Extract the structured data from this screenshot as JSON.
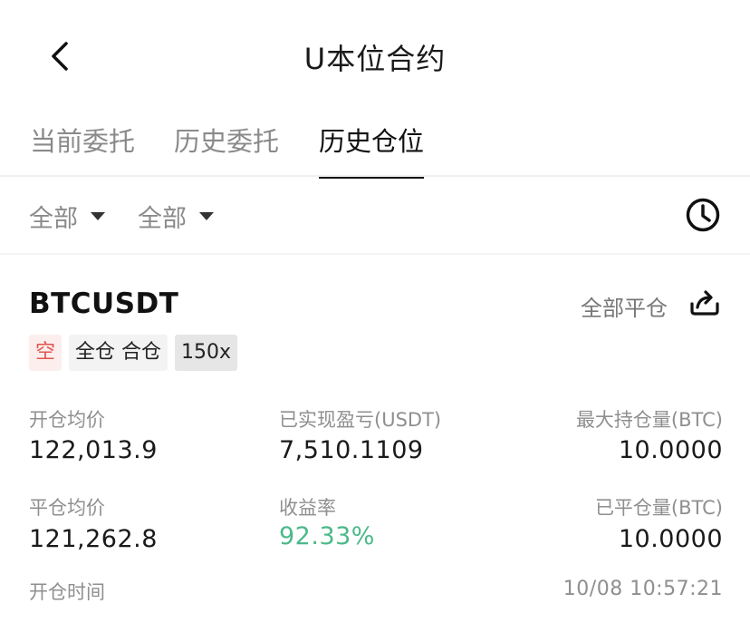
{
  "header": {
    "title": "U本位合约"
  },
  "tabs": [
    {
      "label": "当前委托",
      "active": false
    },
    {
      "label": "历史委托",
      "active": false
    },
    {
      "label": "历史仓位",
      "active": true
    }
  ],
  "filters": [
    {
      "label": "全部"
    },
    {
      "label": "全部"
    }
  ],
  "position": {
    "symbol": "BTCUSDT",
    "close_all_label": "全部平仓",
    "tags": {
      "side": "空",
      "mode": "全仓 合仓",
      "leverage": "150x"
    },
    "fields": {
      "open_avg_price": {
        "label": "开仓均价",
        "value": "122,013.9"
      },
      "realized_pnl": {
        "label": "已实现盈亏(USDT)",
        "value": "7,510.1109"
      },
      "max_position": {
        "label": "最大持仓量(BTC)",
        "value": "10.0000"
      },
      "close_avg_price": {
        "label": "平仓均价",
        "value": "121,262.8"
      },
      "roi": {
        "label": "收益率",
        "value": "92.33%"
      },
      "closed_amount": {
        "label": "已平仓量(BTC)",
        "value": "10.0000"
      },
      "open_time": {
        "label": "开仓时间",
        "value": "10/08 10:57:21"
      }
    }
  },
  "colors": {
    "long_short_tag": "#e0564f",
    "profit": "#4cb98a"
  },
  "icons": {
    "back": "chevron-left-icon",
    "history": "clock-icon",
    "share": "share-icon"
  }
}
